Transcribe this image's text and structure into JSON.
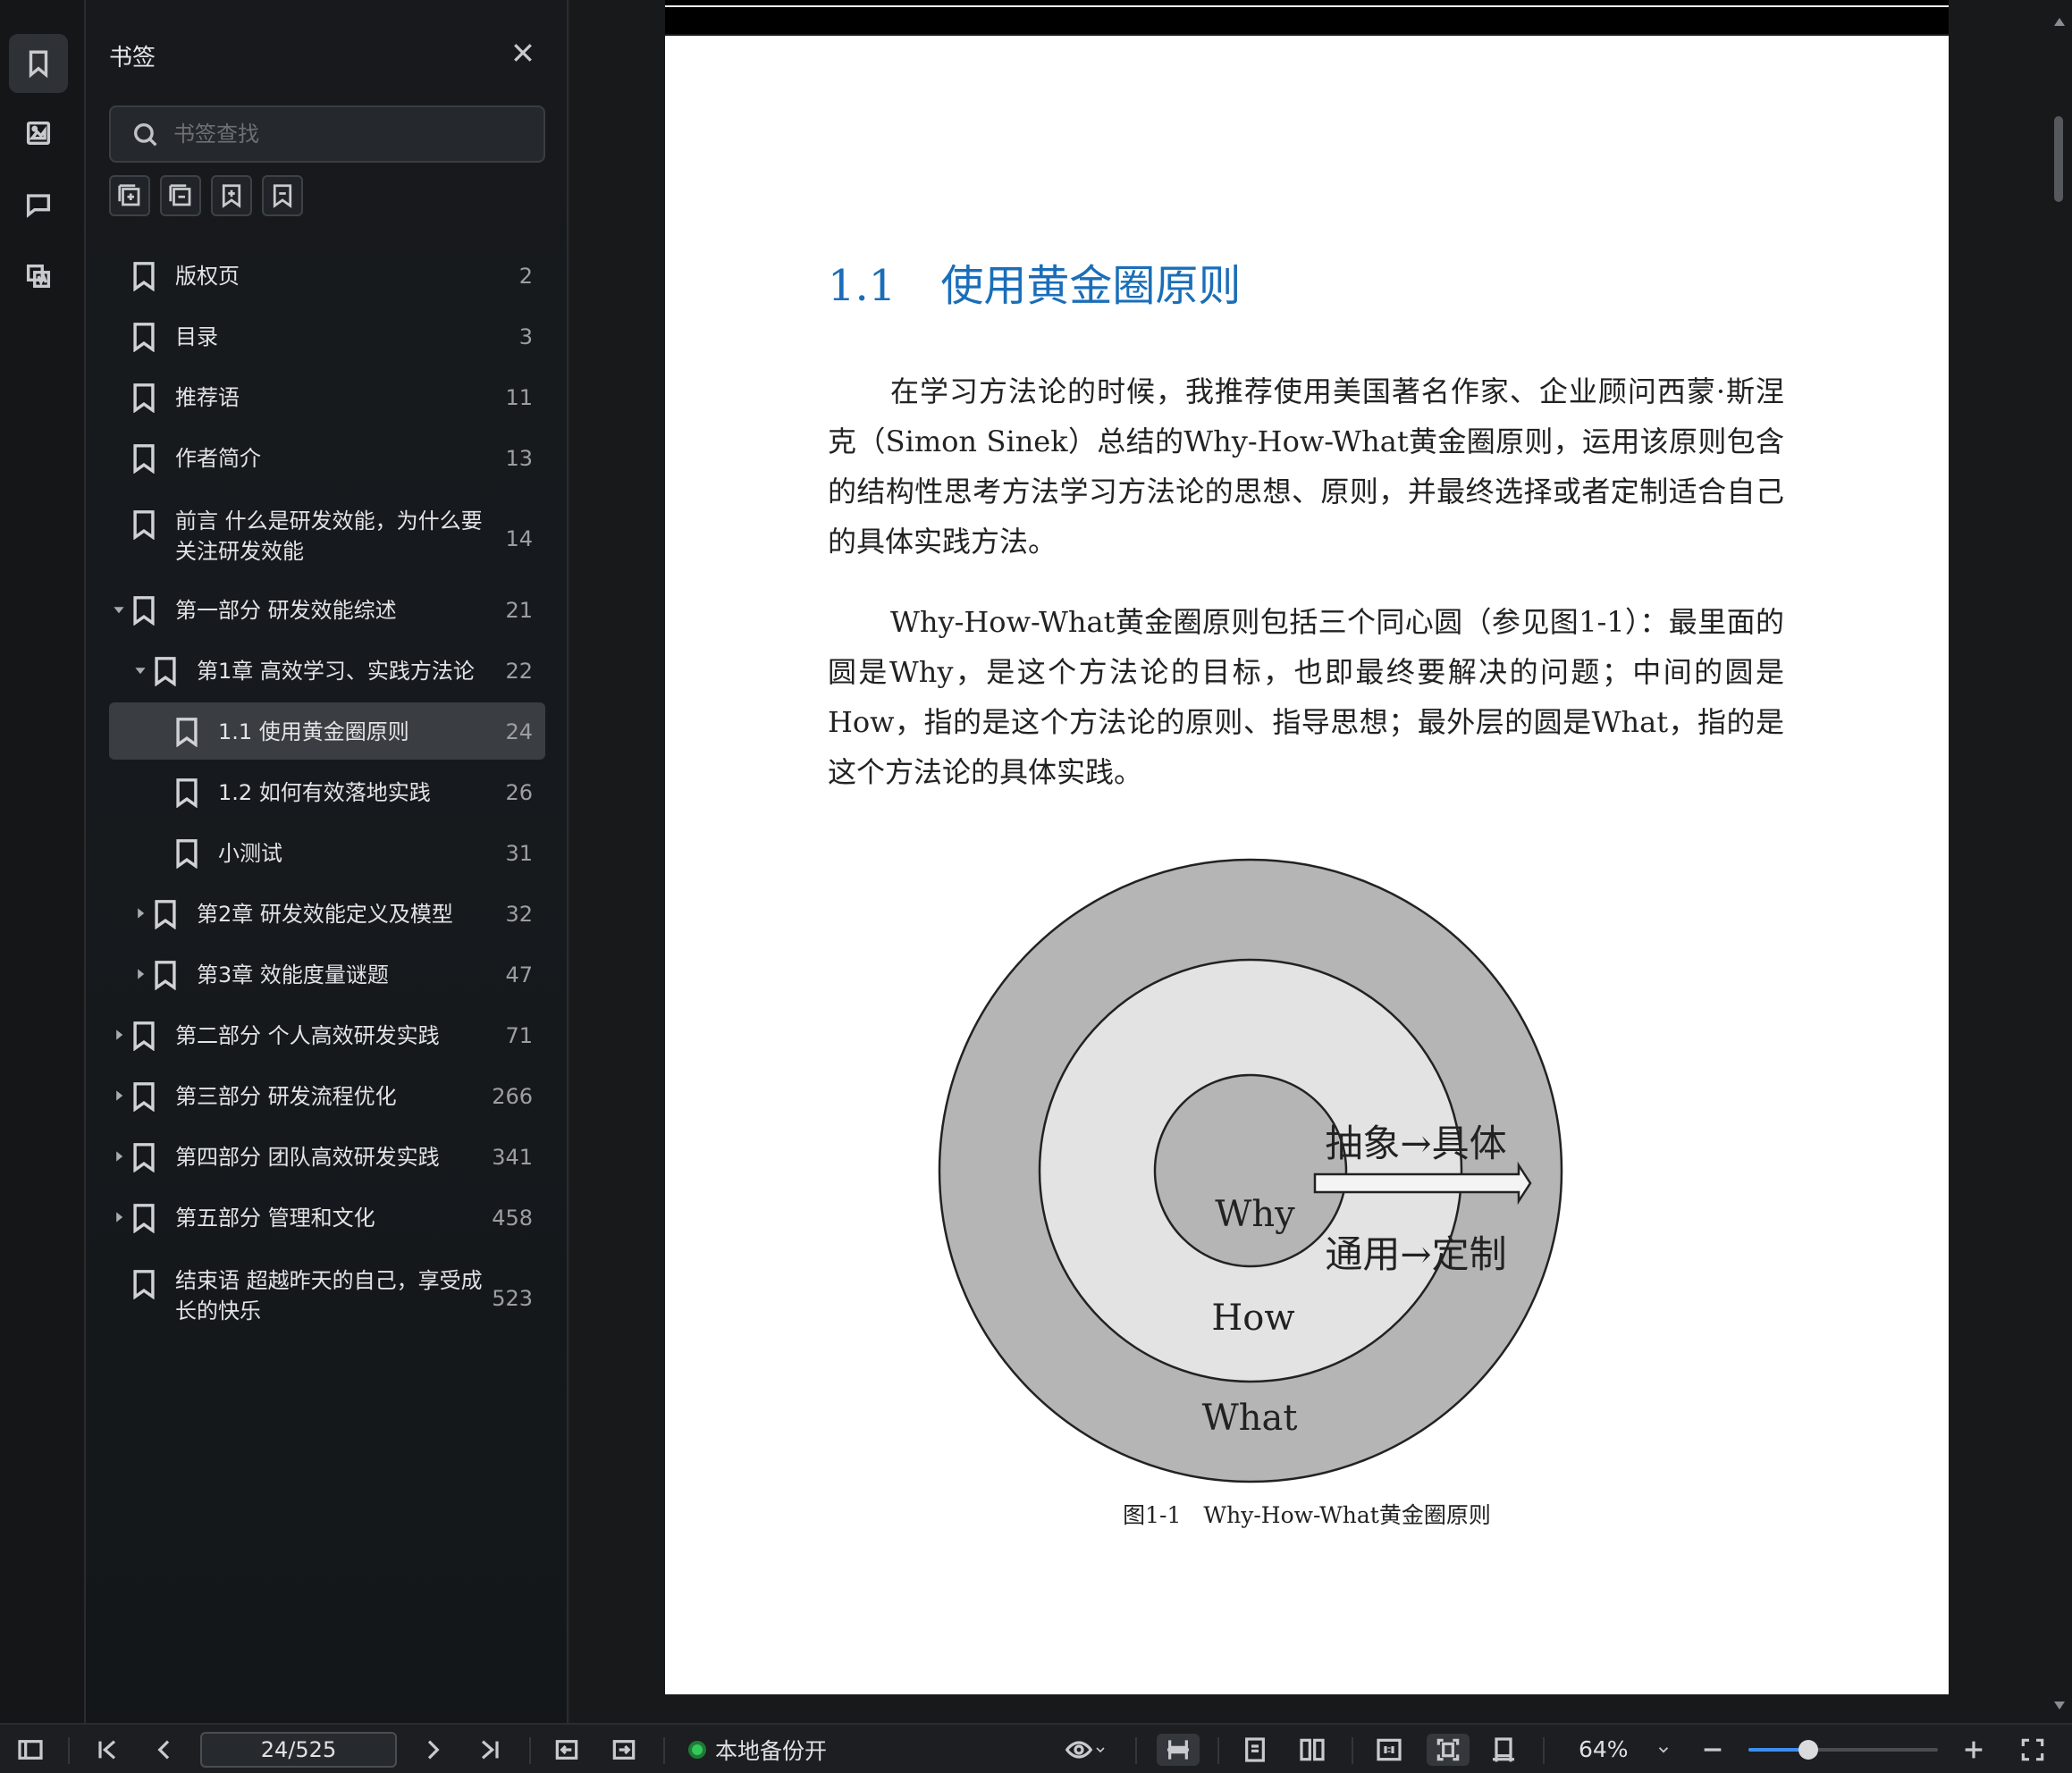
{
  "panel": {
    "title": "书签",
    "search_placeholder": "书签查找"
  },
  "bookmarks": [
    {
      "label": "版权页",
      "page": "2",
      "level": 0,
      "expander": "none"
    },
    {
      "label": "目录",
      "page": "3",
      "level": 0,
      "expander": "none"
    },
    {
      "label": "推荐语",
      "page": "11",
      "level": 0,
      "expander": "none"
    },
    {
      "label": "作者简介",
      "page": "13",
      "level": 0,
      "expander": "none"
    },
    {
      "label": "前言 什么是研发效能，为什么要关注研发效能",
      "page": "14",
      "level": 0,
      "expander": "none"
    },
    {
      "label": "第一部分 研发效能综述",
      "page": "21",
      "level": 0,
      "expander": "open"
    },
    {
      "label": "第1章 高效学习、实践方法论",
      "page": "22",
      "level": 1,
      "expander": "open"
    },
    {
      "label": "1.1 使用黄金圈原则",
      "page": "24",
      "level": 2,
      "expander": "none",
      "selected": true
    },
    {
      "label": "1.2 如何有效落地实践",
      "page": "26",
      "level": 2,
      "expander": "none"
    },
    {
      "label": "小测试",
      "page": "31",
      "level": 2,
      "expander": "none"
    },
    {
      "label": "第2章 研发效能定义及模型",
      "page": "32",
      "level": 1,
      "expander": "closed"
    },
    {
      "label": "第3章 效能度量谜题",
      "page": "47",
      "level": 1,
      "expander": "closed"
    },
    {
      "label": "第二部分 个人高效研发实践",
      "page": "71",
      "level": 0,
      "expander": "closed"
    },
    {
      "label": "第三部分 研发流程优化",
      "page": "266",
      "level": 0,
      "expander": "closed"
    },
    {
      "label": "第四部分 团队高效研发实践",
      "page": "341",
      "level": 0,
      "expander": "closed"
    },
    {
      "label": "第五部分 管理和文化",
      "page": "458",
      "level": 0,
      "expander": "closed"
    },
    {
      "label": "结束语 超越昨天的自己，享受成长的快乐",
      "page": "523",
      "level": 0,
      "expander": "none"
    }
  ],
  "document": {
    "section_number": "1.1",
    "section_title": "使用黄金圈原则",
    "paragraph1": "在学习方法论的时候，我推荐使用美国著名作家、企业顾问西蒙·斯涅克（Simon Sinek）总结的Why-How-What黄金圈原则，运用该原则包含的结构性思考方法学习方法论的思想、原则，并最终选择或者定制适合自己的具体实践方法。",
    "paragraph2": "Why-How-What黄金圈原则包括三个同心圆（参见图1-1）：最里面的圆是Why，是这个方法论的目标，也即最终要解决的问题；中间的圆是How，指的是这个方法论的原则、指导思想；最外层的圆是What，指的是这个方法论的具体实践。",
    "diagram": {
      "inner": "Why",
      "middle": "How",
      "outer": "What",
      "arrow_top": "抽象→具体",
      "arrow_bottom": "通用→定制"
    },
    "caption": "图1-1　Why-How-What黄金圈原则"
  },
  "statusbar": {
    "page_indicator": "24/525",
    "backup_label": "本地备份开",
    "zoom_label": "64%",
    "zoom_value": 0.64,
    "status_color": "#34c759",
    "accent_color": "#3d8ef0"
  },
  "heading_color": "#1a6eb8"
}
